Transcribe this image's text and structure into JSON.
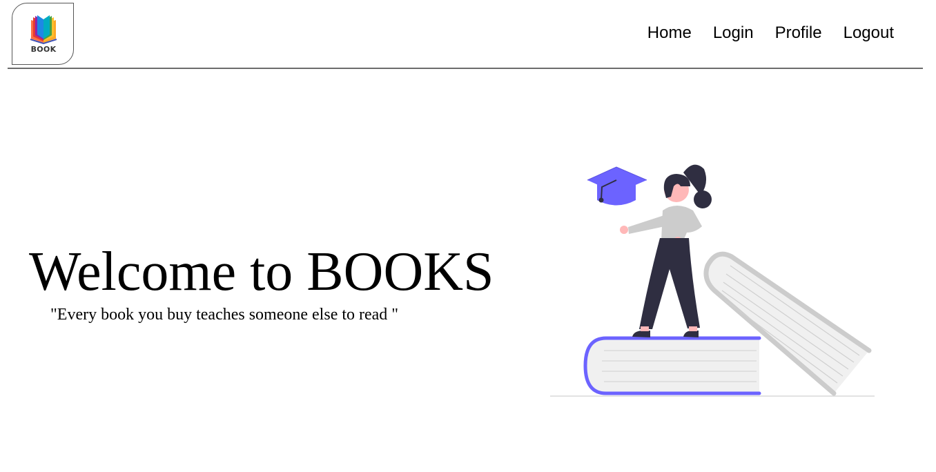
{
  "logo": {
    "text": "BOOK"
  },
  "nav": {
    "items": [
      "Home",
      "Login",
      "Profile",
      "Logout"
    ]
  },
  "hero": {
    "title": "Welcome to BOOKS",
    "quote": "\"Every book you buy teaches someone else to read \""
  },
  "colors": {
    "accent": "#6c63ff",
    "dark": "#2f2e41",
    "grey": "#cccccc",
    "skin": "#ffb8b8",
    "divider": "#6b6b6b"
  }
}
